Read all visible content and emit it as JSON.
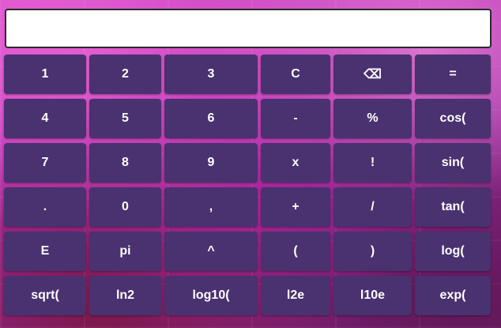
{
  "display": {
    "value": ""
  },
  "keys": [
    {
      "label": "1",
      "name": "key-1"
    },
    {
      "label": "2",
      "name": "key-2"
    },
    {
      "label": "3",
      "name": "key-3"
    },
    {
      "label": "C",
      "name": "clear-button"
    },
    {
      "label": "⌫",
      "name": "backspace-icon"
    },
    {
      "label": "=",
      "name": "equals-button"
    },
    {
      "label": "4",
      "name": "key-4"
    },
    {
      "label": "5",
      "name": "key-5"
    },
    {
      "label": "6",
      "name": "key-6"
    },
    {
      "label": "-",
      "name": "minus-button"
    },
    {
      "label": "%",
      "name": "percent-button"
    },
    {
      "label": "cos(",
      "name": "cos-button"
    },
    {
      "label": "7",
      "name": "key-7"
    },
    {
      "label": "8",
      "name": "key-8"
    },
    {
      "label": "9",
      "name": "key-9"
    },
    {
      "label": "x",
      "name": "multiply-button"
    },
    {
      "label": "!",
      "name": "factorial-button"
    },
    {
      "label": "sin(",
      "name": "sin-button"
    },
    {
      "label": ".",
      "name": "decimal-button"
    },
    {
      "label": "0",
      "name": "key-0"
    },
    {
      "label": ",",
      "name": "comma-button"
    },
    {
      "label": "+",
      "name": "plus-button"
    },
    {
      "label": "/",
      "name": "divide-button"
    },
    {
      "label": "tan(",
      "name": "tan-button"
    },
    {
      "label": "E",
      "name": "e-constant-button"
    },
    {
      "label": "pi",
      "name": "pi-button"
    },
    {
      "label": "^",
      "name": "power-button"
    },
    {
      "label": "(",
      "name": "open-paren-button"
    },
    {
      "label": ")",
      "name": "close-paren-button"
    },
    {
      "label": "log(",
      "name": "log-button"
    },
    {
      "label": "sqrt(",
      "name": "sqrt-button"
    },
    {
      "label": "ln2",
      "name": "ln2-button"
    },
    {
      "label": "log10(",
      "name": "log10-button"
    },
    {
      "label": "l2e",
      "name": "log2e-button"
    },
    {
      "label": "l10e",
      "name": "log10e-button"
    },
    {
      "label": "exp(",
      "name": "exp-button"
    }
  ]
}
